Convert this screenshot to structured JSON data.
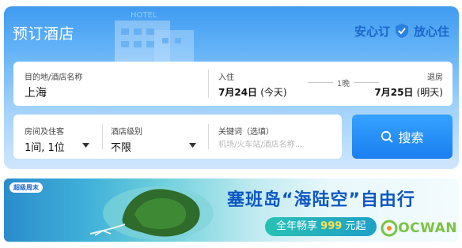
{
  "header": {
    "title": "预订酒店",
    "building_sign": "HOTEL",
    "trust_badge_left": "安心订",
    "trust_badge_right": "放心住"
  },
  "search": {
    "destination_label": "目的地/酒店名称",
    "destination_value": "上海",
    "checkin_label": "入住",
    "checkin_date": "7月24日",
    "checkin_day": "(今天)",
    "nights": "1晚",
    "checkout_label": "退房",
    "checkout_date": "7月25日",
    "checkout_day": "(明天)",
    "rooms_label": "房间及住客",
    "rooms_value": "1间, 1位",
    "level_label": "酒店级别",
    "level_value": "不限",
    "keyword_label": "关键词（选填）",
    "keyword_value": "",
    "keyword_placeholder": "机场/火车站/酒店名称...",
    "search_button": "搜索"
  },
  "banner": {
    "logo_text": "超级周末",
    "headline": "塞班岛“海陆空”自由行",
    "pill_prefix": "全年畅享",
    "pill_price": "999",
    "pill_suffix": "元起"
  },
  "watermark": {
    "text": "OCWAN"
  },
  "colors": {
    "accent": "#1b7ff0",
    "brand_dark": "#0d57c2",
    "watermark_green": "#7cc244"
  }
}
